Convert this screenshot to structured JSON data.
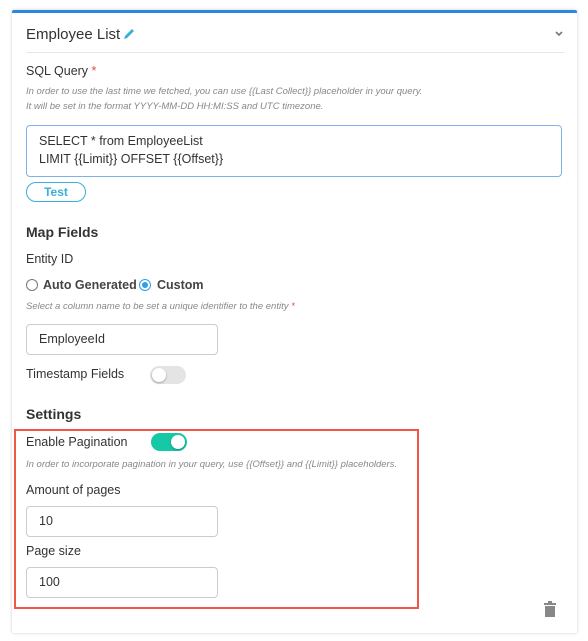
{
  "card": {
    "title": "Employee List",
    "edit_icon": "pencil-icon",
    "collapse_icon": "chevron-down-icon",
    "accent": "#2e86de"
  },
  "sql": {
    "label": "SQL Query",
    "required": "*",
    "hint_1": "In order to use the last time we fetched, you can use {{Last Collect}} placeholder in your query.",
    "hint_2": "It will be set in the format YYYY-MM-DD HH:MI:SS and UTC timezone.",
    "value": "SELECT * from EmployeeList\nLIMIT {{Limit}} OFFSET {{Offset}}",
    "test_label": "Test"
  },
  "map_fields": {
    "heading": "Map Fields",
    "entity_id_label": "Entity ID",
    "options": [
      {
        "label": "Auto Generated",
        "selected": false
      },
      {
        "label": "Custom",
        "selected": true
      }
    ],
    "column_hint": "Select a column name to be set a unique identifier to the entity",
    "required": "*",
    "entity_value": "EmployeeId",
    "timestamp_label": "Timestamp Fields",
    "timestamp_enabled": false
  },
  "settings": {
    "heading": "Settings",
    "pagination_label": "Enable Pagination",
    "pagination_enabled": true,
    "pagination_color": "#16c9a6",
    "pagination_hint": "In order to incorporate pagination in your query, use {{Offset}} and {{Limit}} placeholders.",
    "pages_label": "Amount of pages",
    "pages_value": "10",
    "size_label": "Page size",
    "size_value": "100",
    "highlight_color": "#f0574a"
  },
  "delete_icon": "trash-icon"
}
